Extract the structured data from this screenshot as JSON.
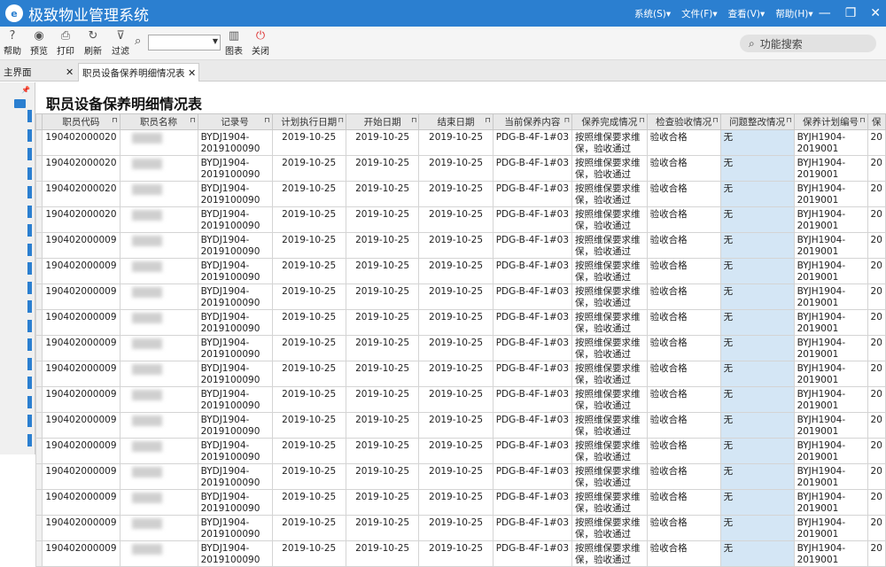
{
  "app": {
    "title": "极致物业管理系统",
    "logo_text": "e"
  },
  "menus": [
    "系统(S)▾",
    "文件(F)▾",
    "查看(V)▾",
    "帮助(H)▾"
  ],
  "window_controls": [
    "—",
    "❐",
    "✕"
  ],
  "toolbar": {
    "buttons": [
      {
        "label": "帮助",
        "icon": "help-icon",
        "glyph": "?"
      },
      {
        "label": "预览",
        "icon": "eye-icon",
        "glyph": "◉"
      },
      {
        "label": "打印",
        "icon": "printer-icon",
        "glyph": "⎙"
      },
      {
        "label": "刷新",
        "icon": "refresh-icon",
        "glyph": "↻"
      },
      {
        "label": "过滤",
        "icon": "filter-icon",
        "glyph": "⊽"
      }
    ],
    "chart_label": "图表",
    "close_label": "关闭",
    "func_search": "功能搜索"
  },
  "tabs": [
    {
      "label": "主界面",
      "close": "✕"
    },
    {
      "label": "职员设备保养明细情况表",
      "close": "✕"
    }
  ],
  "report": {
    "title": "职员设备保养明细情况表",
    "headers": [
      "职员代码",
      "职员名称",
      "记录号",
      "计划执行日期",
      "开始日期",
      "结束日期",
      "当前保养内容",
      "保养完成情况",
      "检查验收情况",
      "问题整改情况",
      "保养计划编号",
      "保"
    ],
    "rows": [
      {
        "code": "190402000020",
        "rec": "BYDJ1904-",
        "rec2": "2019100090",
        "plan": "2019-10-25",
        "start": "2019-10-25",
        "end": "2019-10-25",
        "content": "PDG-B-4F-1#03",
        "done": "按照维保要求维",
        "done2": "保，验收通过",
        "check": "验收合格",
        "issue": "无",
        "planno": "BYJH1904-",
        "planno2": "2019001",
        "last": "20"
      },
      {
        "code": "190402000020",
        "rec": "BYDJ1904-",
        "rec2": "2019100090",
        "plan": "2019-10-25",
        "start": "2019-10-25",
        "end": "2019-10-25",
        "content": "PDG-B-4F-1#03",
        "done": "按照维保要求维",
        "done2": "保，验收通过",
        "check": "验收合格",
        "issue": "无",
        "planno": "BYJH1904-",
        "planno2": "2019001",
        "last": "20"
      },
      {
        "code": "190402000020",
        "rec": "BYDJ1904-",
        "rec2": "2019100090",
        "plan": "2019-10-25",
        "start": "2019-10-25",
        "end": "2019-10-25",
        "content": "PDG-B-4F-1#03",
        "done": "按照维保要求维",
        "done2": "保，验收通过",
        "check": "验收合格",
        "issue": "无",
        "planno": "BYJH1904-",
        "planno2": "2019001",
        "last": "20"
      },
      {
        "code": "190402000020",
        "rec": "BYDJ1904-",
        "rec2": "2019100090",
        "plan": "2019-10-25",
        "start": "2019-10-25",
        "end": "2019-10-25",
        "content": "PDG-B-4F-1#03",
        "done": "按照维保要求维",
        "done2": "保，验收通过",
        "check": "验收合格",
        "issue": "无",
        "planno": "BYJH1904-",
        "planno2": "2019001",
        "last": "20"
      },
      {
        "code": "190402000009",
        "rec": "BYDJ1904-",
        "rec2": "2019100090",
        "plan": "2019-10-25",
        "start": "2019-10-25",
        "end": "2019-10-25",
        "content": "PDG-B-4F-1#03",
        "done": "按照维保要求维",
        "done2": "保，验收通过",
        "check": "验收合格",
        "issue": "无",
        "planno": "BYJH1904-",
        "planno2": "2019001",
        "last": "20"
      },
      {
        "code": "190402000009",
        "rec": "BYDJ1904-",
        "rec2": "2019100090",
        "plan": "2019-10-25",
        "start": "2019-10-25",
        "end": "2019-10-25",
        "content": "PDG-B-4F-1#03",
        "done": "按照维保要求维",
        "done2": "保，验收通过",
        "check": "验收合格",
        "issue": "无",
        "planno": "BYJH1904-",
        "planno2": "2019001",
        "last": "20"
      },
      {
        "code": "190402000009",
        "rec": "BYDJ1904-",
        "rec2": "2019100090",
        "plan": "2019-10-25",
        "start": "2019-10-25",
        "end": "2019-10-25",
        "content": "PDG-B-4F-1#03",
        "done": "按照维保要求维",
        "done2": "保，验收通过",
        "check": "验收合格",
        "issue": "无",
        "planno": "BYJH1904-",
        "planno2": "2019001",
        "last": "20"
      },
      {
        "code": "190402000009",
        "rec": "BYDJ1904-",
        "rec2": "2019100090",
        "plan": "2019-10-25",
        "start": "2019-10-25",
        "end": "2019-10-25",
        "content": "PDG-B-4F-1#03",
        "done": "按照维保要求维",
        "done2": "保，验收通过",
        "check": "验收合格",
        "issue": "无",
        "planno": "BYJH1904-",
        "planno2": "2019001",
        "last": "20"
      },
      {
        "code": "190402000009",
        "rec": "BYDJ1904-",
        "rec2": "2019100090",
        "plan": "2019-10-25",
        "start": "2019-10-25",
        "end": "2019-10-25",
        "content": "PDG-B-4F-1#03",
        "done": "按照维保要求维",
        "done2": "保，验收通过",
        "check": "验收合格",
        "issue": "无",
        "planno": "BYJH1904-",
        "planno2": "2019001",
        "last": "20"
      },
      {
        "code": "190402000009",
        "rec": "BYDJ1904-",
        "rec2": "2019100090",
        "plan": "2019-10-25",
        "start": "2019-10-25",
        "end": "2019-10-25",
        "content": "PDG-B-4F-1#03",
        "done": "按照维保要求维",
        "done2": "保，验收通过",
        "check": "验收合格",
        "issue": "无",
        "planno": "BYJH1904-",
        "planno2": "2019001",
        "last": "20"
      },
      {
        "code": "190402000009",
        "rec": "BYDJ1904-",
        "rec2": "2019100090",
        "plan": "2019-10-25",
        "start": "2019-10-25",
        "end": "2019-10-25",
        "content": "PDG-B-4F-1#03",
        "done": "按照维保要求维",
        "done2": "保，验收通过",
        "check": "验收合格",
        "issue": "无",
        "planno": "BYJH1904-",
        "planno2": "2019001",
        "last": "20"
      },
      {
        "code": "190402000009",
        "rec": "BYDJ1904-",
        "rec2": "2019100090",
        "plan": "2019-10-25",
        "start": "2019-10-25",
        "end": "2019-10-25",
        "content": "PDG-B-4F-1#03",
        "done": "按照维保要求维",
        "done2": "保，验收通过",
        "check": "验收合格",
        "issue": "无",
        "planno": "BYJH1904-",
        "planno2": "2019001",
        "last": "20"
      },
      {
        "code": "190402000009",
        "rec": "BYDJ1904-",
        "rec2": "2019100090",
        "plan": "2019-10-25",
        "start": "2019-10-25",
        "end": "2019-10-25",
        "content": "PDG-B-4F-1#03",
        "done": "按照维保要求维",
        "done2": "保，验收通过",
        "check": "验收合格",
        "issue": "无",
        "planno": "BYJH1904-",
        "planno2": "2019001",
        "last": "20"
      },
      {
        "code": "190402000009",
        "rec": "BYDJ1904-",
        "rec2": "2019100090",
        "plan": "2019-10-25",
        "start": "2019-10-25",
        "end": "2019-10-25",
        "content": "PDG-B-4F-1#03",
        "done": "按照维保要求维",
        "done2": "保，验收通过",
        "check": "验收合格",
        "issue": "无",
        "planno": "BYJH1904-",
        "planno2": "2019001",
        "last": "20"
      },
      {
        "code": "190402000009",
        "rec": "BYDJ1904-",
        "rec2": "2019100090",
        "plan": "2019-10-25",
        "start": "2019-10-25",
        "end": "2019-10-25",
        "content": "PDG-B-4F-1#03",
        "done": "按照维保要求维",
        "done2": "保，验收通过",
        "check": "验收合格",
        "issue": "无",
        "planno": "BYJH1904-",
        "planno2": "2019001",
        "last": "20"
      },
      {
        "code": "190402000009",
        "rec": "BYDJ1904-",
        "rec2": "2019100090",
        "plan": "2019-10-25",
        "start": "2019-10-25",
        "end": "2019-10-25",
        "content": "PDG-B-4F-1#03",
        "done": "按照维保要求维",
        "done2": "保，验收通过",
        "check": "验收合格",
        "issue": "无",
        "planno": "BYJH1904-",
        "planno2": "2019001",
        "last": "20"
      },
      {
        "code": "190402000009",
        "rec": "BYDJ1904-",
        "rec2": "2019100090",
        "plan": "2019-10-25",
        "start": "2019-10-25",
        "end": "2019-10-25",
        "content": "PDG-B-4F-1#03",
        "done": "按照维保要求维",
        "done2": "保，验收通过",
        "check": "验收合格",
        "issue": "无",
        "planno": "BYJH1904-",
        "planno2": "2019001",
        "last": "20"
      }
    ]
  },
  "colors": {
    "accent": "#2b7fd0",
    "issue_cell": "#d4e6f5"
  }
}
